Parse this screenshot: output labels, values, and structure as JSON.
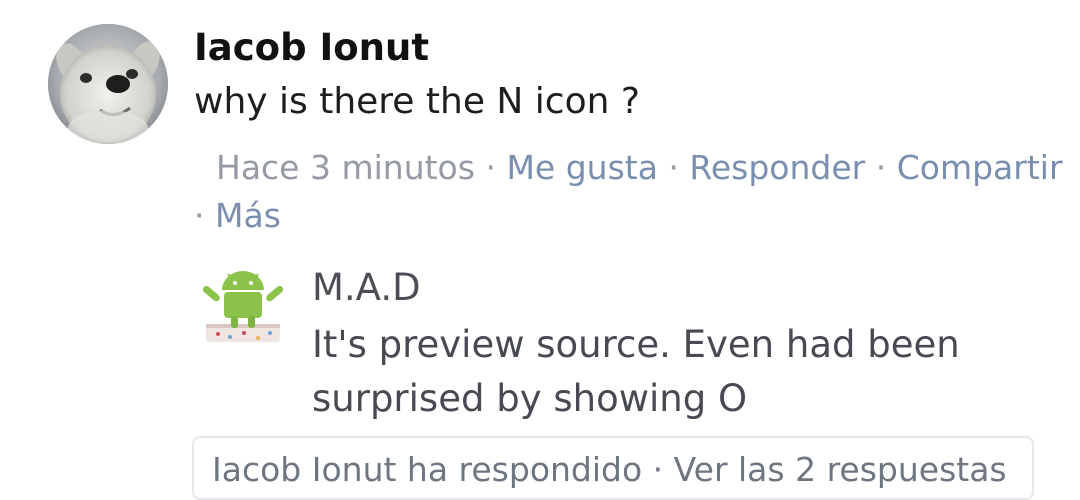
{
  "comment": {
    "author": "Iacob Ionut",
    "text": "why is there the N icon ?",
    "time": "Hace 3 minutos",
    "separator": "·",
    "actions": {
      "like": "Me gusta",
      "reply": "Responder",
      "share": "Compartir",
      "more": "Más"
    },
    "avatar_icon": "dog-avatar-icon"
  },
  "reply": {
    "author": "M.A.D",
    "text": "It's preview source. Even had been surprised by showing O",
    "avatar_icon": "android-nougat-avatar-icon"
  },
  "reply_box": {
    "partial_text": "Iacob Ionut ha respondido · Ver las 2 respuestas"
  },
  "colors": {
    "action_link": "#7a8fb0",
    "android_green": "#8bc34a"
  }
}
